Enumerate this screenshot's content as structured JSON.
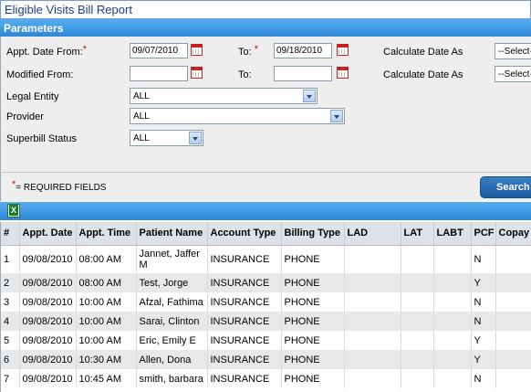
{
  "title": "Eligible Visits Bill Report",
  "parameters_label": "Parameters",
  "fields": {
    "appt_date_from_label": "Appt. Date From:",
    "appt_date_from_value": "09/07/2010",
    "to_label": "To:",
    "appt_date_to_value": "09/18/2010",
    "calc_date_as_label": "Calculate Date As",
    "calc_date_as_value": "--Select--",
    "modified_from_label": "Modified From:",
    "modified_from_value": "",
    "modified_to_label": "To:",
    "modified_to_value": "",
    "calc_date_as_label_2": "Calculate Date As",
    "calc_date_as_value_2": "--Select--",
    "legal_entity_label": "Legal Entity",
    "legal_entity_value": "ALL",
    "provider_label": "Provider",
    "provider_value": "ALL",
    "superbill_status_label": "Superbill Status",
    "superbill_status_value": "ALL",
    "required_asterisk": "*",
    "required_note": "= REQUIRED FIELDS",
    "search_label": "Search"
  },
  "table": {
    "columns": [
      "#",
      "Appt. Date",
      "Appt. Time",
      "Patient Name",
      "Account Type",
      "Billing Type",
      "LAD",
      "LAT",
      "LABT",
      "PCF",
      "Copay"
    ],
    "rows": [
      [
        "1",
        "09/08/2010",
        "08:00 AM",
        "Jannet, Jaffer M",
        "INSURANCE",
        "PHONE",
        "",
        "",
        "",
        "N",
        ""
      ],
      [
        "2",
        "09/08/2010",
        "08:00 AM",
        "Test, Jorge",
        "INSURANCE",
        "PHONE",
        "",
        "",
        "",
        "Y",
        ""
      ],
      [
        "3",
        "09/08/2010",
        "10:00 AM",
        "Afzal, Fathima",
        "INSURANCE",
        "PHONE",
        "",
        "",
        "",
        "N",
        ""
      ],
      [
        "4",
        "09/08/2010",
        "10:00 AM",
        "Sarai, Clinton",
        "INSURANCE",
        "PHONE",
        "",
        "",
        "",
        "N",
        ""
      ],
      [
        "5",
        "09/08/2010",
        "10:00 AM",
        "Eric, Emily E",
        "INSURANCE",
        "PHONE",
        "",
        "",
        "",
        "Y",
        ""
      ],
      [
        "6",
        "09/08/2010",
        "10:30 AM",
        "Allen, Dona",
        "INSURANCE",
        "PHONE",
        "",
        "",
        "",
        "Y",
        ""
      ],
      [
        "7",
        "09/08/2010",
        "10:45 AM",
        "smith, barbara",
        "INSURANCE",
        "PHONE",
        "",
        "",
        "",
        "N",
        ""
      ]
    ]
  },
  "colors": {
    "header_blue": "#2f86d6",
    "title_blue": "#1f3d8a",
    "required_red": "#e00000",
    "search_blue": "#1a5a9e"
  },
  "icons": {
    "calendar": "calendar-icon",
    "excel": "excel-export-icon",
    "dropdown": "chevron-down-icon"
  }
}
